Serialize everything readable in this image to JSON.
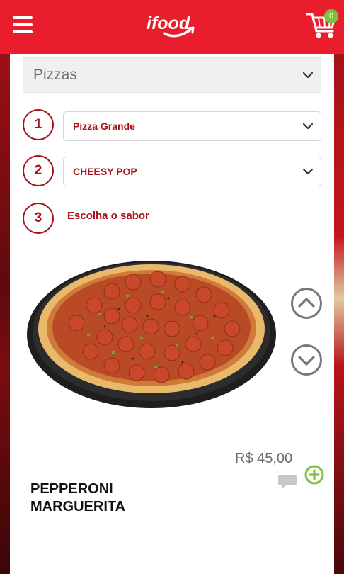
{
  "header": {
    "logo_text": "ifood",
    "cart_count": "0",
    "brand_color": "#ea1d2c",
    "icons": [
      "menu-icon",
      "cart-icon"
    ]
  },
  "category": {
    "selected": "Pizzas"
  },
  "steps": [
    {
      "number": "1",
      "value": "Pizza Grande"
    },
    {
      "number": "2",
      "value": "CHEESY POP"
    },
    {
      "number": "3",
      "label": "Escolha o sabor"
    }
  ],
  "product": {
    "price": "R$ 45,00",
    "name_line1": "PEPPERONI",
    "name_line2": "MARGUERITA"
  },
  "colors": {
    "accent": "#a8101a",
    "add": "#7cc242"
  }
}
